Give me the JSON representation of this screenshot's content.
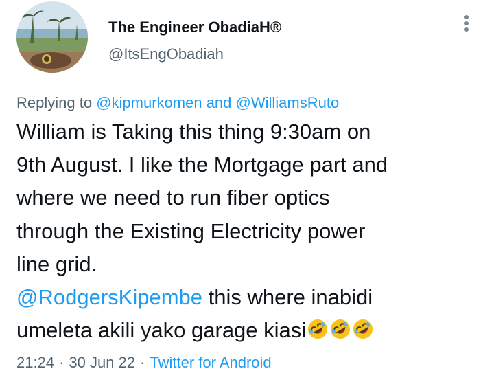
{
  "author": {
    "display_name": "The Engineer ObadiaH®",
    "handle": "@ItsEngObadiah"
  },
  "reply": {
    "prefix": "Replying to ",
    "mention_1": "@kipmurkomen",
    "joiner": " and ",
    "mention_2": "@WilliamsRuto"
  },
  "tweet": {
    "line_1": "William is Taking this thing 9:30am on",
    "line_2": "9th August. I like the Mortgage part and",
    "line_3": "where we need to run fiber optics",
    "line_4": "through the Existing Electricity power",
    "line_5": "line grid.",
    "mention": "@RodgersKipembe",
    "line_6_rest": " this where inabidi",
    "line_7": "umeleta akili yako garage kiasi",
    "emojis": [
      "rolling-on-floor-laughing",
      "rolling-on-floor-laughing",
      "rolling-on-floor-laughing"
    ]
  },
  "meta": {
    "time": "21:24",
    "separator": "·",
    "date": "30 Jun 22",
    "source": "Twitter for Android"
  },
  "colors": {
    "link": "#1d9bf0",
    "secondary_text": "#536471",
    "primary_text": "#0f1419"
  }
}
